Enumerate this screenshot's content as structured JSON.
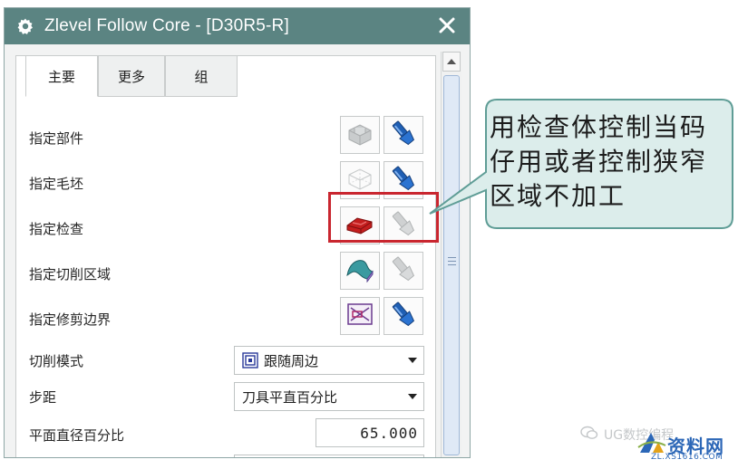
{
  "dialog": {
    "title": "Zlevel Follow Core - [D30R5-R]",
    "tabs": [
      {
        "label": "主要",
        "active": true
      },
      {
        "label": "更多",
        "active": false
      },
      {
        "label": "组",
        "active": false
      }
    ],
    "geometry_rows": [
      {
        "label": "指定部件",
        "select_icon": "part-geometry-icon",
        "action_icon": "flashlight-icon"
      },
      {
        "label": "指定毛坯",
        "select_icon": "blank-geometry-icon",
        "action_icon": "flashlight-icon"
      },
      {
        "label": "指定检查",
        "select_icon": "check-geometry-icon",
        "action_icon": "flashlight-disabled-icon"
      },
      {
        "label": "指定切削区域",
        "select_icon": "cut-area-icon",
        "action_icon": "flashlight-disabled-icon"
      },
      {
        "label": "指定修剪边界",
        "select_icon": "trim-boundary-icon",
        "action_icon": "flashlight-icon"
      }
    ],
    "fields": {
      "cut_pattern": {
        "label": "切削模式",
        "value": "跟随周边"
      },
      "stepover": {
        "label": "步距",
        "value": "刀具平直百分比"
      },
      "percent_flat_diameter": {
        "label": "平面直径百分比",
        "value": "65.000"
      }
    }
  },
  "callout": {
    "lines": [
      "用检查体控制当码",
      "仔用或者控制狭窄",
      "区域不加工"
    ]
  },
  "watermark": {
    "left_text": "UG数控编程",
    "brand": "资料网",
    "url": "ZL.XS1616.COM"
  },
  "colors": {
    "titlebar": "#5b8482",
    "highlight": "#c9262f",
    "callout_fill": "#dcedeb",
    "callout_border": "#5f9d96",
    "flashlight": "#1f5fb4",
    "check_body": "#c41e1e"
  }
}
